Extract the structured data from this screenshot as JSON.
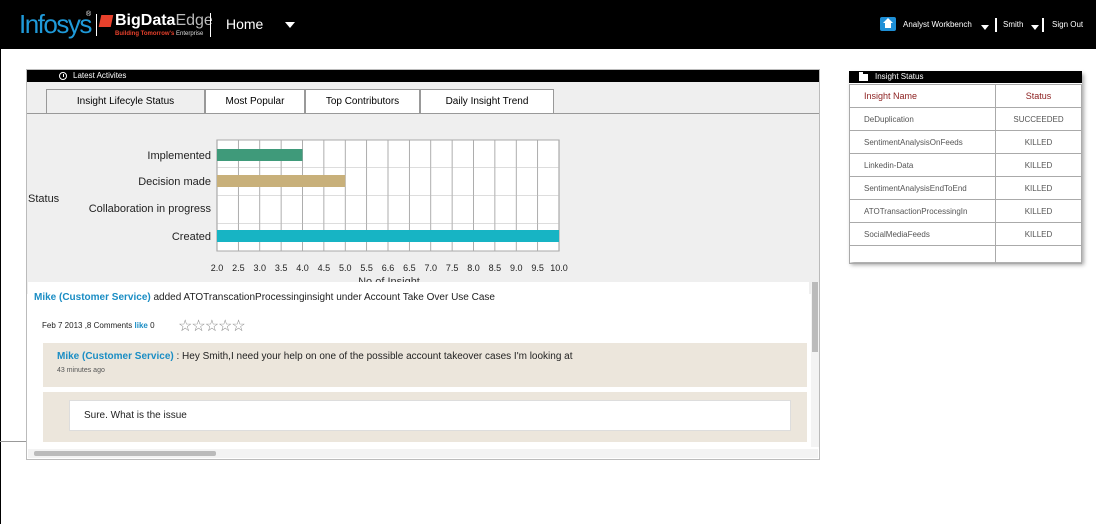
{
  "header": {
    "brand": "Infosys",
    "brand_reg": "®",
    "product_bold": "BigData",
    "product_rest": "Edge",
    "tagline_highlight": "Building Tomorrow's",
    "tagline_rest": " Enterprise",
    "home_label": "Home",
    "analyst_workbench": "Analyst Workbench",
    "user": "Smith",
    "sign_out": "Sign Out"
  },
  "activities": {
    "title": "Latest Activites",
    "tabs": [
      "Insight Lifecyle Status",
      "Most Popular",
      "Top Contributors",
      "Daily Insight Trend"
    ],
    "active_tab": 0,
    "post": {
      "author": "Mike (Customer Service)",
      "text": " added ATOTranscationProcessinginsight under Account Take Over Use Case",
      "meta": "Feb 7 2013 ,8 Comments ",
      "like_label": "like",
      "like_count": " 0",
      "stars": "☆☆☆☆☆"
    },
    "comment": {
      "author": "Mike (Customer Service)",
      "text": " : Hey Smith,I need your help on one of the possible account takeover cases I'm looking at",
      "time": "43 minutes ago"
    },
    "reply": "Sure. What is the issue"
  },
  "chart_data": {
    "type": "bar",
    "orientation": "horizontal",
    "categories": [
      "Implemented",
      "Decision made",
      "Collaboration in progress",
      "Created"
    ],
    "values": [
      4.0,
      5.0,
      null,
      10.0
    ],
    "colors": [
      "#3f9a7a",
      "#c8b07a",
      "#cccccc",
      "#17b4c4"
    ],
    "xlabel": "No of Insight",
    "ylabel": "Status",
    "xlim": [
      2.0,
      10.0
    ],
    "xticks": [
      "2.0",
      "2.5",
      "3.0",
      "3.5",
      "4.0",
      "4.5",
      "5.0",
      "5.5",
      "6.6",
      "6.5",
      "7.0",
      "7.5",
      "8.0",
      "8.5",
      "9.0",
      "9.5",
      "10.0"
    ],
    "grid": true
  },
  "insight_status": {
    "title": "Insight Status",
    "headers": [
      "Insight Name",
      "Status"
    ],
    "rows": [
      [
        "DeDuplication",
        "SUCCEEDED"
      ],
      [
        "SentimentAnalysisOnFeeds",
        "KILLED"
      ],
      [
        "Linkedin-Data",
        "KILLED"
      ],
      [
        "SentimentAnalysisEndToEnd",
        "KILLED"
      ],
      [
        "ATOTransactionProcessingIn",
        "KILLED"
      ],
      [
        "SocialMediaFeeds",
        "KILLED"
      ]
    ]
  }
}
